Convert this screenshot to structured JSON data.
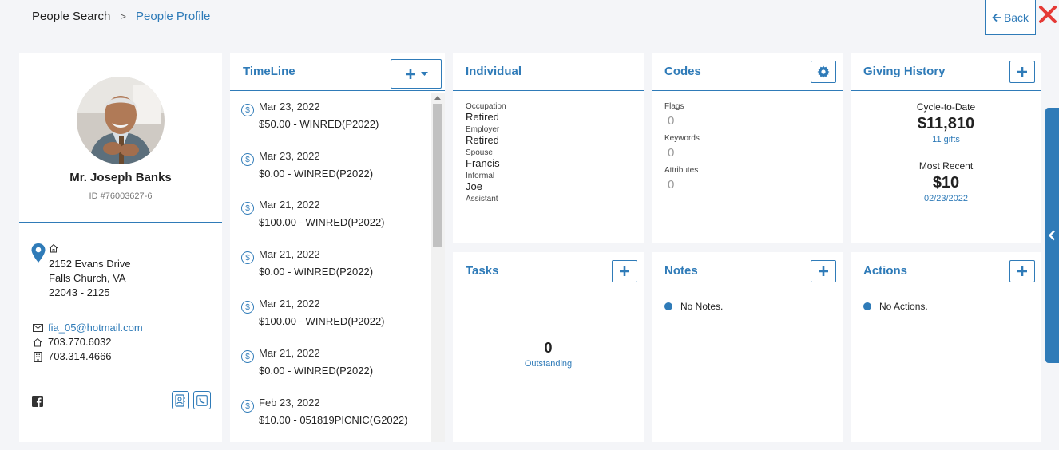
{
  "breadcrumb": {
    "parent": "People Search",
    "separator": ">",
    "current": "People Profile"
  },
  "back_label": "Back",
  "profile": {
    "name": "Mr. Joseph Banks",
    "id": "ID #76003627-6",
    "address": [
      "2152 Evans Drive",
      "Falls Church, VA",
      "22043 - 2125"
    ],
    "email": "fia_05@hotmail.com",
    "home_phone": "703.770.6032",
    "work_phone": "703.314.4666"
  },
  "timeline": {
    "title": "TimeLine",
    "items": [
      {
        "date": "Mar 23, 2022",
        "amount": "$50.00 - WINRED(P2022)"
      },
      {
        "date": "Mar 23, 2022",
        "amount": "$0.00 - WINRED(P2022)"
      },
      {
        "date": "Mar 21, 2022",
        "amount": "$100.00 - WINRED(P2022)"
      },
      {
        "date": "Mar 21, 2022",
        "amount": "$0.00 - WINRED(P2022)"
      },
      {
        "date": "Mar 21, 2022",
        "amount": "$100.00 - WINRED(P2022)"
      },
      {
        "date": "Mar 21, 2022",
        "amount": "$0.00 - WINRED(P2022)"
      },
      {
        "date": "Feb 23, 2022",
        "amount": "$10.00 - 051819PICNIC(G2022)"
      }
    ]
  },
  "individual": {
    "title": "Individual",
    "occupation_label": "Occupation",
    "occupation": "Retired",
    "employer_label": "Employer",
    "employer": "Retired",
    "spouse_label": "Spouse",
    "spouse": "Francis",
    "informal_label": "Informal",
    "informal": "Joe",
    "assistant_label": "Assistant"
  },
  "codes": {
    "title": "Codes",
    "flags_label": "Flags",
    "flags": "0",
    "keywords_label": "Keywords",
    "keywords": "0",
    "attributes_label": "Attributes",
    "attributes": "0"
  },
  "giving": {
    "title": "Giving History",
    "ctd_label": "Cycle-to-Date",
    "ctd_amount": "$11,810",
    "ctd_gifts": "11 gifts",
    "recent_label": "Most Recent",
    "recent_amount": "$10",
    "recent_date": "02/23/2022"
  },
  "tasks": {
    "title": "Tasks",
    "count": "0",
    "label": "Outstanding"
  },
  "notes": {
    "title": "Notes",
    "empty": "No Notes."
  },
  "actions": {
    "title": "Actions",
    "empty": "No Actions."
  },
  "colors": {
    "accent": "#2f7bb8",
    "close": "#e53935",
    "background": "#f4f5f8"
  }
}
